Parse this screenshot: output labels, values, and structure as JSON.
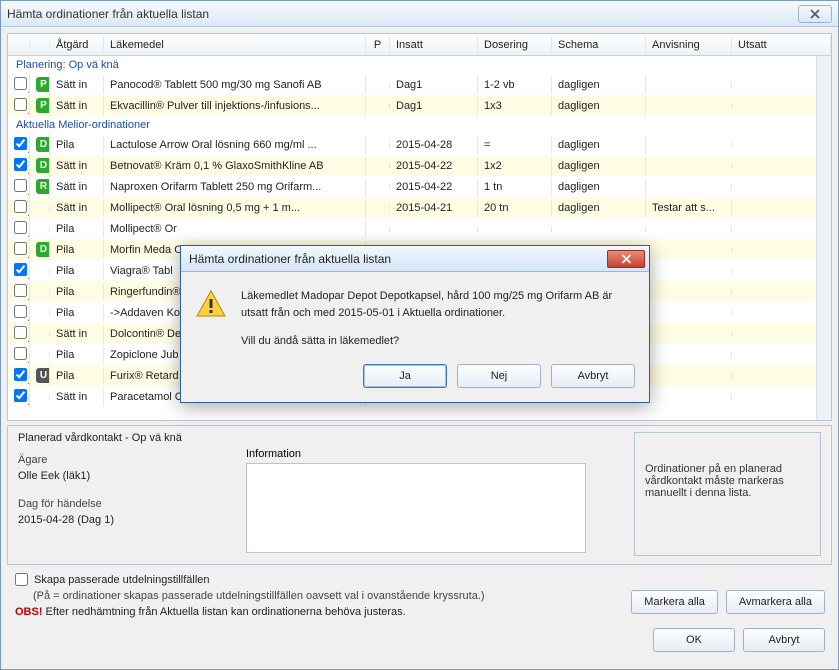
{
  "window": {
    "title": "Hämta ordinationer från aktuella listan"
  },
  "columns": {
    "atgard": "Åtgärd",
    "lakemedel": "Läkemedel",
    "p": "P",
    "insatt": "Insatt",
    "dosering": "Dosering",
    "schema": "Schema",
    "anvisning": "Anvisning",
    "utsatt": "Utsatt"
  },
  "groups": {
    "planering": "Planering: Op vä knä",
    "aktuella": "Aktuella Melior-ordinationer"
  },
  "rows": [
    {
      "chk": false,
      "icon": "P",
      "atg": "Sätt in",
      "med": "Panocod® Tablett 500 mg/30 mg Sanofi AB",
      "ins": "Dag1",
      "dos": "1-2 vb",
      "sch": "dagligen",
      "anv": "",
      "alt": false
    },
    {
      "chk": false,
      "icon": "P",
      "atg": "Sätt in",
      "med": "Ekvacillin® Pulver till injektions-/infusions...",
      "ins": "Dag1",
      "dos": "1x3",
      "sch": "dagligen",
      "anv": "",
      "alt": true
    }
  ],
  "rows2": [
    {
      "chk": true,
      "icon": "D",
      "atg": "Pila",
      "med": "Lactulose Arrow Oral lösning 660 mg/ml ...",
      "ins": "2015-04-28",
      "dos": "=",
      "sch": "dagligen",
      "anv": "",
      "alt": false
    },
    {
      "chk": true,
      "icon": "D",
      "atg": "Sätt in",
      "med": "Betnovat® Kräm 0,1 % GlaxoSmithKline AB",
      "ins": "2015-04-22",
      "dos": "1x2",
      "sch": "dagligen",
      "anv": "",
      "alt": true
    },
    {
      "chk": false,
      "icon": "R",
      "atg": "Sätt in",
      "med": "Naproxen Orifarm Tablett 250 mg Orifarm...",
      "ins": "2015-04-22",
      "dos": "1 tn",
      "sch": "dagligen",
      "anv": "",
      "alt": false
    },
    {
      "chk": false,
      "icon": "",
      "atg": "Sätt in",
      "med": "Mollipect® Oral lösning 0,5 mg + 1 m...",
      "ins": "2015-04-21",
      "dos": "20 tn",
      "sch": "dagligen",
      "anv": "Testar att s...",
      "alt": true
    },
    {
      "chk": false,
      "icon": "",
      "atg": "Pila",
      "med": "Mollipect® Or",
      "ins": "",
      "dos": "",
      "sch": "",
      "anv": "",
      "alt": false
    },
    {
      "chk": false,
      "icon": "D",
      "atg": "Pila",
      "med": "Morfin Meda O",
      "ins": "",
      "dos": "",
      "sch": "",
      "anv": "",
      "alt": true
    },
    {
      "chk": true,
      "icon": "",
      "atg": "Pila",
      "med": "Viagra® Tabl",
      "ins": "",
      "dos": "",
      "sch": "",
      "anv": "",
      "alt": false
    },
    {
      "chk": false,
      "icon": "",
      "atg": "Pila",
      "med": "Ringerfundin®",
      "ins": "",
      "dos": "",
      "sch": "",
      "anv": "",
      "alt": true
    },
    {
      "chk": false,
      "icon": "",
      "atg": "Pila",
      "med": "->Addaven Ko",
      "ins": "",
      "dos": "",
      "sch": "",
      "anv": "",
      "alt": false
    },
    {
      "chk": false,
      "icon": "",
      "atg": "Sätt in",
      "med": "Dolcontin® De",
      "ins": "",
      "dos": "",
      "sch": "",
      "anv": "",
      "alt": true
    },
    {
      "chk": false,
      "icon": "",
      "atg": "Pila",
      "med": "Zopiclone Jub",
      "ins": "",
      "dos": "",
      "sch": "",
      "anv": "",
      "alt": false
    },
    {
      "chk": true,
      "icon": "U",
      "atg": "Pila",
      "med": "Furix® Retard",
      "ins": "",
      "dos": "",
      "sch": "",
      "anv": "",
      "alt": true
    },
    {
      "chk": true,
      "icon": "",
      "atg": "Sätt in",
      "med": "Paracetamol C",
      "ins": "",
      "dos": "",
      "sch": "",
      "anv": "",
      "alt": false
    }
  ],
  "lowerPanel": {
    "heading": "Planerad vårdkontakt - Op vä knä",
    "agareLabel": "Ägare",
    "agareValue": "Olle Eek (läk1)",
    "dagLabel": "Dag för händelse",
    "dagValue": "2015-04-28 (Dag 1)",
    "infoLabel": "Information",
    "rightText": "Ordinationer på en planerad vårdkontakt måste markeras manuellt i denna lista."
  },
  "bottom": {
    "cbLabel": "Skapa passerade utdelningstillfällen",
    "hint": "(På = ordinationer skapas passerade utdelningstillfällen oavsett val i ovanstående kryssruta.)",
    "obs": "OBS!",
    "obsText": " Efter nedhämtning från Aktuella listan kan ordinationerna behöva justeras."
  },
  "buttons": {
    "markeraAlla": "Markera alla",
    "avmarkeraAlla": "Avmarkera alla",
    "ok": "OK",
    "avbryt": "Avbryt"
  },
  "modal": {
    "title": "Hämta ordinationer från aktuella listan",
    "line1": "Läkemedlet Madopar Depot Depotkapsel, hård 100 mg/25 mg Orifarm AB är utsatt från och med 2015-05-01 i Aktuella ordinationer.",
    "line2": "Vill du ändå sätta in läkemedlet?",
    "ja": "Ja",
    "nej": "Nej",
    "avbryt": "Avbryt"
  }
}
